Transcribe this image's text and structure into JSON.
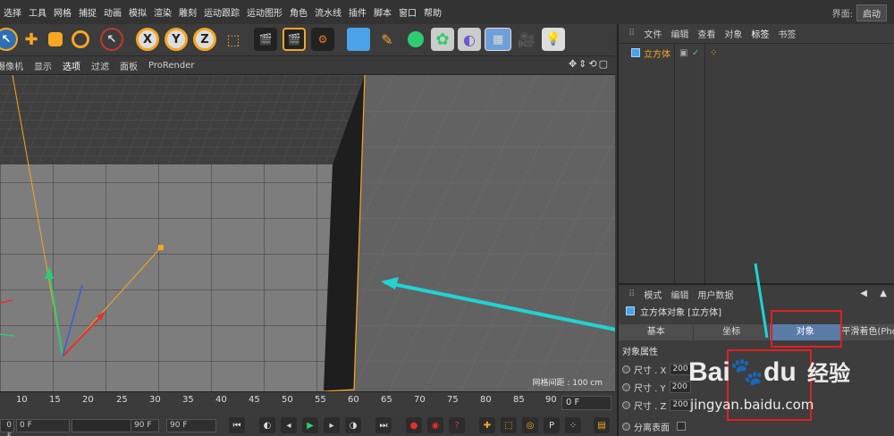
{
  "menu": [
    "选择",
    "工具",
    "网格",
    "捕捉",
    "动画",
    "模拟",
    "渲染",
    "雕刻",
    "运动跟踪",
    "运动图形",
    "角色",
    "流水线",
    "插件",
    "脚本",
    "窗口",
    "帮助"
  ],
  "layout": {
    "label": "界面:",
    "value": "启动"
  },
  "toolbar": {
    "x": "X",
    "y": "Y",
    "z": "Z"
  },
  "viewport_menu": [
    "摄像机",
    "显示",
    "选项",
    "过滤",
    "面板",
    "ProRender"
  ],
  "viewport": {
    "grid_label": "网格间距 : 100 cm"
  },
  "timeline": {
    "ticks": [
      "10",
      "15",
      "20",
      "25",
      "30",
      "35",
      "40",
      "45",
      "50",
      "55",
      "60",
      "65",
      "70",
      "75",
      "80",
      "85",
      "90"
    ],
    "frame": "0 F"
  },
  "playbar": {
    "start": "0 F",
    "end": "90 F",
    "fps": "90 F"
  },
  "object_manager": {
    "menu": [
      "文件",
      "编辑",
      "查看",
      "对象",
      "标签",
      "书签"
    ],
    "active_menu": "标签",
    "object_name": "立方体"
  },
  "attributes": {
    "menu": [
      "模式",
      "编辑",
      "用户数据"
    ],
    "title": "立方体对象 [立方体]",
    "tabs": [
      "基本",
      "坐标",
      "对象",
      "平滑着色(Pho"
    ],
    "selected_tab": "对象",
    "section": "对象属性",
    "rows": [
      {
        "label": "尺寸 . X",
        "value": "200"
      },
      {
        "label": "尺寸 . Y",
        "value": "200"
      },
      {
        "label": "尺寸 . Z",
        "value": "200"
      }
    ],
    "separate_label": "分离表面"
  },
  "watermark": {
    "brand": "Bai",
    "brand2": "du",
    "cn": "经验",
    "url": "jingyan.baidu.com"
  },
  "colors": {
    "accent": "#f5a623",
    "selected_tab": "#5c7ca8",
    "annotation": "#e02020",
    "arrow": "#22d3d3"
  }
}
